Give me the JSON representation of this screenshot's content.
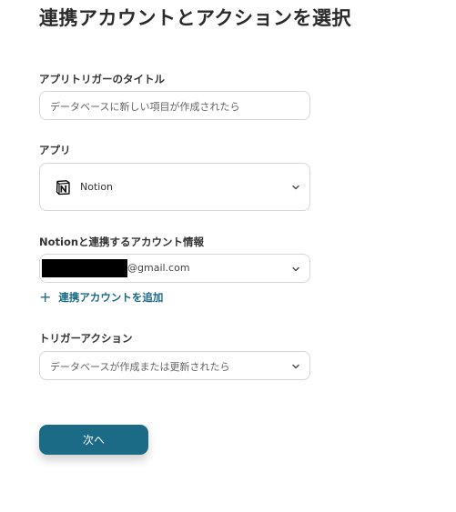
{
  "page": {
    "title": "連携アカウントとアクションを選択"
  },
  "trigger_title": {
    "label": "アプリトリガーのタイトル",
    "value": "データベースに新しい項目が作成されたら"
  },
  "app": {
    "label": "アプリ",
    "selected": "Notion",
    "icon": "notion-logo-icon"
  },
  "account": {
    "label": "Notionと連携するアカウント情報",
    "email_suffix": "@gmail.com",
    "add_link": "連携アカウントを追加"
  },
  "trigger_action": {
    "label": "トリガーアクション",
    "selected": "データベースが作成または更新されたら"
  },
  "next_button": "次へ",
  "colors": {
    "accent": "#1b6a86",
    "link": "#1d6a86",
    "border": "#d6d6d6"
  }
}
